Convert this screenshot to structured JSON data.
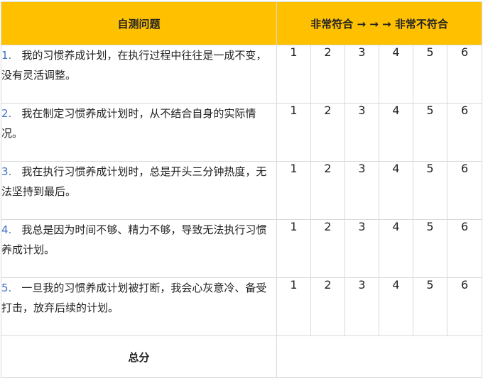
{
  "header": {
    "question_col": "自测问题",
    "scale_label": "非常符合 → → →  非常不符合"
  },
  "scores": [
    "1",
    "2",
    "3",
    "4",
    "5",
    "6"
  ],
  "questions": [
    {
      "num": "1.",
      "text": "我的习惯养成计划，在执行过程中往往是一成不变，没有灵活调整。"
    },
    {
      "num": "2.",
      "text": "我在制定习惯养成计划时，从不结合自身的实际情况。"
    },
    {
      "num": "3.",
      "text": "我在执行习惯养成计划时，总是开头三分钟热度，无法坚持到最后。"
    },
    {
      "num": "4.",
      "text": "我总是因为时间不够、精力不够，导致无法执行习惯养成计划。"
    },
    {
      "num": "5.",
      "text": "一旦我的习惯养成计划被打断，我会心灰意冷、备受打击，放弃后续的计划。"
    }
  ],
  "total": {
    "label": "总分",
    "value": ""
  }
}
